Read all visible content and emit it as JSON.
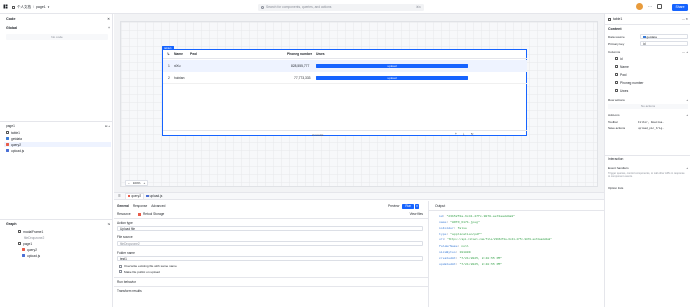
{
  "topbar": {
    "breadcrumb": [
      "个人文档",
      "page1"
    ],
    "search_placeholder": "Search for components, queries, and actions",
    "shortcut": "⌘K",
    "share_label": "Share"
  },
  "left": {
    "code_title": "Code",
    "global_label": "Global",
    "no_code": "No code",
    "page_label": "page1",
    "files": [
      "table1",
      "getdata",
      "query2",
      "upload.js"
    ],
    "graph_label": "Graph",
    "graph_items": [
      "modalFrame1",
      "fileDropzone2",
      "page1",
      "query2",
      "upload.js"
    ]
  },
  "canvas": {
    "table_tag": "table1",
    "columns": [
      "Name",
      "Pwd",
      "Phoneg number",
      "Uwes"
    ],
    "rows": [
      {
        "idx": "1",
        "name": "xiXu",
        "pwd": "",
        "phone": "828,555,777",
        "action": "upload"
      },
      {
        "idx": "2",
        "name": "huixian",
        "pwd": "",
        "phone": "77,773,333",
        "action": "upload"
      }
    ],
    "results": "2 results",
    "zoom": "100%"
  },
  "query": {
    "tabs": [
      "query2",
      "upload.js"
    ],
    "subtabs": [
      "General",
      "Response",
      "Advanced"
    ],
    "resource_label": "Resource",
    "resource_value": "Retool Storage",
    "preview_label": "Preview",
    "run_label": "Run",
    "view_files": "View files",
    "action_type_label": "Action type",
    "action_type_value": "Upload file",
    "file_source_label": "File source",
    "file_source_value": "fileDropzone2",
    "folder_name_label": "Folder name",
    "folder_name_value": "test1",
    "check1": "Overwrite existing file with same name",
    "check2": "Make file public on upload",
    "run_behavior": "Run behavior",
    "transform": "Transform results"
  },
  "output": {
    "title": "Output",
    "lines": [
      {
        "k": "id",
        "v": "\"23b52f2a-6c41-47fc-9070-ae72aadd4a8\""
      },
      {
        "k": "name",
        "v": "\"HOTO_6171.jpeg\""
      },
      {
        "k": "isFolder",
        "v": "false"
      },
      {
        "k": "type",
        "v": "\"application/pdf\""
      },
      {
        "k": "url",
        "v": "\"https://api.retool.com/file/23b52f2a-6c41-47fc-9070-ae72aadd4a8\""
      },
      {
        "k": "folderName",
        "v": "null"
      },
      {
        "k": "sizeBytes",
        "v": "191809"
      },
      {
        "k": "createdAt",
        "v": "\"7/21/2025, 8:48:55 PM\""
      },
      {
        "k": "updatedAt",
        "v": "\"7/21/2025, 8:48:55 PM\""
      }
    ]
  },
  "inspector": {
    "title": "table1",
    "content_label": "Content",
    "data_source_label": "Data source",
    "data_source_value": "getdata",
    "primary_key_label": "Primary key",
    "primary_key_value": "id",
    "columns_label": "Columns",
    "columns": [
      "id",
      "Name",
      "Pwd",
      "Phoneg number",
      "Uwes"
    ],
    "row_actions": "Row actions",
    "no_actions": "No actions",
    "add_ons": "Add-ons",
    "toolbar_label": "Toolbar",
    "toolbar_value": "Filter, Downloa…",
    "save_actions_label": "Save actions",
    "save_actions_value": "upload_pic_trig…",
    "interaction": "Interaction",
    "event_handlers": "Event handlers",
    "event_hint": "Trigger queries, control components, or call other APIs in response to component events.",
    "option_lists": "Option lists"
  },
  "colors": {
    "accent": "#1664ff",
    "canvas": "#f2f3f5",
    "key": "#3a7bd5",
    "value": "#2f9e44"
  }
}
